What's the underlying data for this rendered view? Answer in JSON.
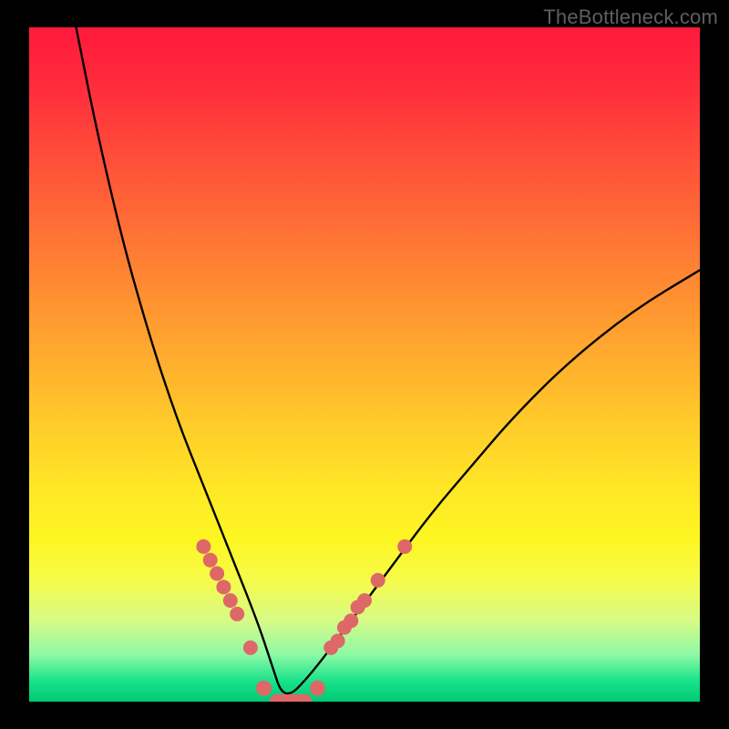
{
  "watermark": "TheBottleneck.com",
  "colors": {
    "background_frame": "#000000",
    "dot_fill": "#de6868",
    "curve_stroke": "#000000",
    "gradient_stops": [
      "#ff1a3c",
      "#ff4a3a",
      "#ff8a32",
      "#ffc92a",
      "#fdf622",
      "#d6fb86",
      "#18e28a",
      "#00c874"
    ]
  },
  "chart_data": {
    "type": "line",
    "title": "",
    "xlabel": "",
    "ylabel": "",
    "xlim": [
      0,
      100
    ],
    "ylim": [
      0,
      100
    ],
    "grid": false,
    "legend": null,
    "note": "V-shaped curve; minimum near x≈38 at y≈0. No axis ticks visible.",
    "series": [
      {
        "name": "curve",
        "x": [
          7,
          10,
          14,
          18,
          22,
          26,
          30,
          34,
          36,
          38,
          42,
          48,
          54,
          60,
          66,
          72,
          80,
          90,
          100
        ],
        "y": [
          100,
          85,
          68,
          54,
          42,
          32,
          22,
          12,
          6,
          0,
          4,
          12,
          20,
          28,
          35,
          42,
          50,
          58,
          64
        ]
      }
    ],
    "markers": [
      {
        "name": "left-dots",
        "x": [
          26,
          27,
          28,
          29,
          30,
          31,
          33
        ],
        "y": [
          23,
          21,
          19,
          17,
          15,
          13,
          8
        ]
      },
      {
        "name": "bottom-dots",
        "x": [
          35,
          37,
          38,
          39,
          40,
          41,
          43
        ],
        "y": [
          2,
          0,
          0,
          0,
          0,
          0,
          2
        ]
      },
      {
        "name": "right-dots",
        "x": [
          45,
          46,
          47,
          48,
          49,
          50,
          52,
          56
        ],
        "y": [
          8,
          9,
          11,
          12,
          14,
          15,
          18,
          23
        ]
      }
    ]
  }
}
